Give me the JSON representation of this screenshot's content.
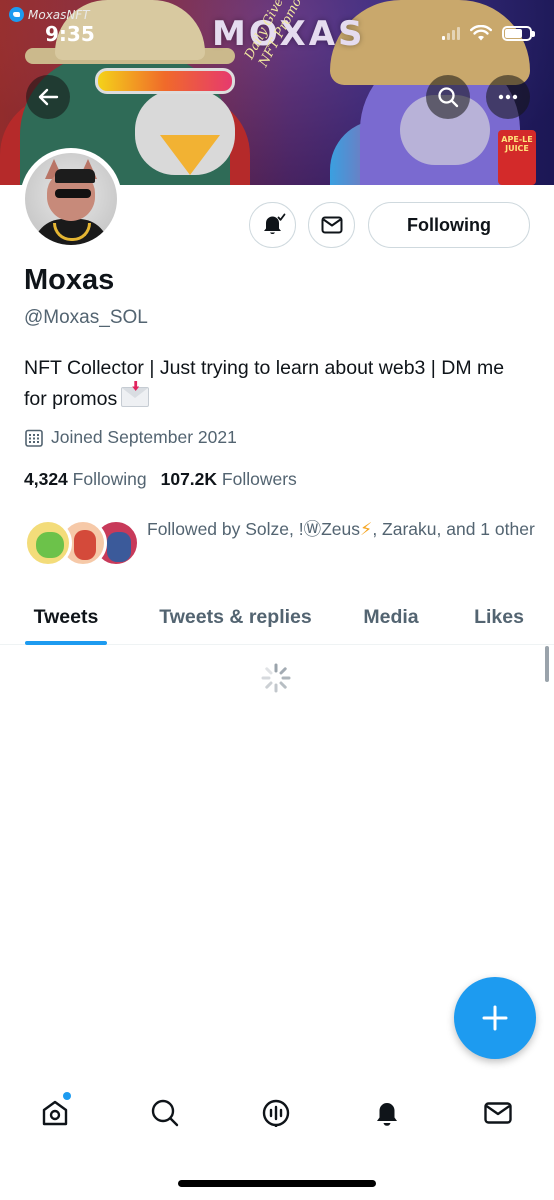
{
  "status_bar": {
    "time": "9:35",
    "watermark": "MoxasNFT"
  },
  "banner": {
    "brand_word": "MOXAS",
    "promo_lines": [
      "Daily Giveaways",
      "NFT Promoter"
    ],
    "juice_label": "APE-LE JUICE"
  },
  "profile": {
    "display_name": "Moxas",
    "handle": "@Moxas_SOL",
    "bio": "NFT Collector | Just trying to learn about web3 | DM me for promos",
    "joined": "Joined September 2021",
    "following_count": "4,324",
    "following_label": "Following",
    "followers_count": "107.2K",
    "followers_label": "Followers",
    "followed_by_prefix": "Followed by Solze, !ⓌZeus",
    "followed_by_suffix": ", Zaraku, and 1 other"
  },
  "actions": {
    "following_button": "Following"
  },
  "tabs": [
    {
      "label": "Tweets",
      "active": true
    },
    {
      "label": "Tweets & replies",
      "active": false
    },
    {
      "label": "Media",
      "active": false
    },
    {
      "label": "Likes",
      "active": false
    }
  ],
  "colors": {
    "accent": "#1d9bf0",
    "text_primary": "#0f1419",
    "text_secondary": "#536471",
    "border": "#cfd9de"
  },
  "icons": {
    "back": "arrow-left-icon",
    "search": "search-icon",
    "more": "more-horizontal-icon",
    "bell": "bell-check-icon",
    "mail": "mail-icon",
    "calendar": "calendar-icon",
    "compose": "plus-icon",
    "nav": [
      "home-icon",
      "search-icon",
      "spaces-icon",
      "bell-icon",
      "mail-icon"
    ]
  }
}
